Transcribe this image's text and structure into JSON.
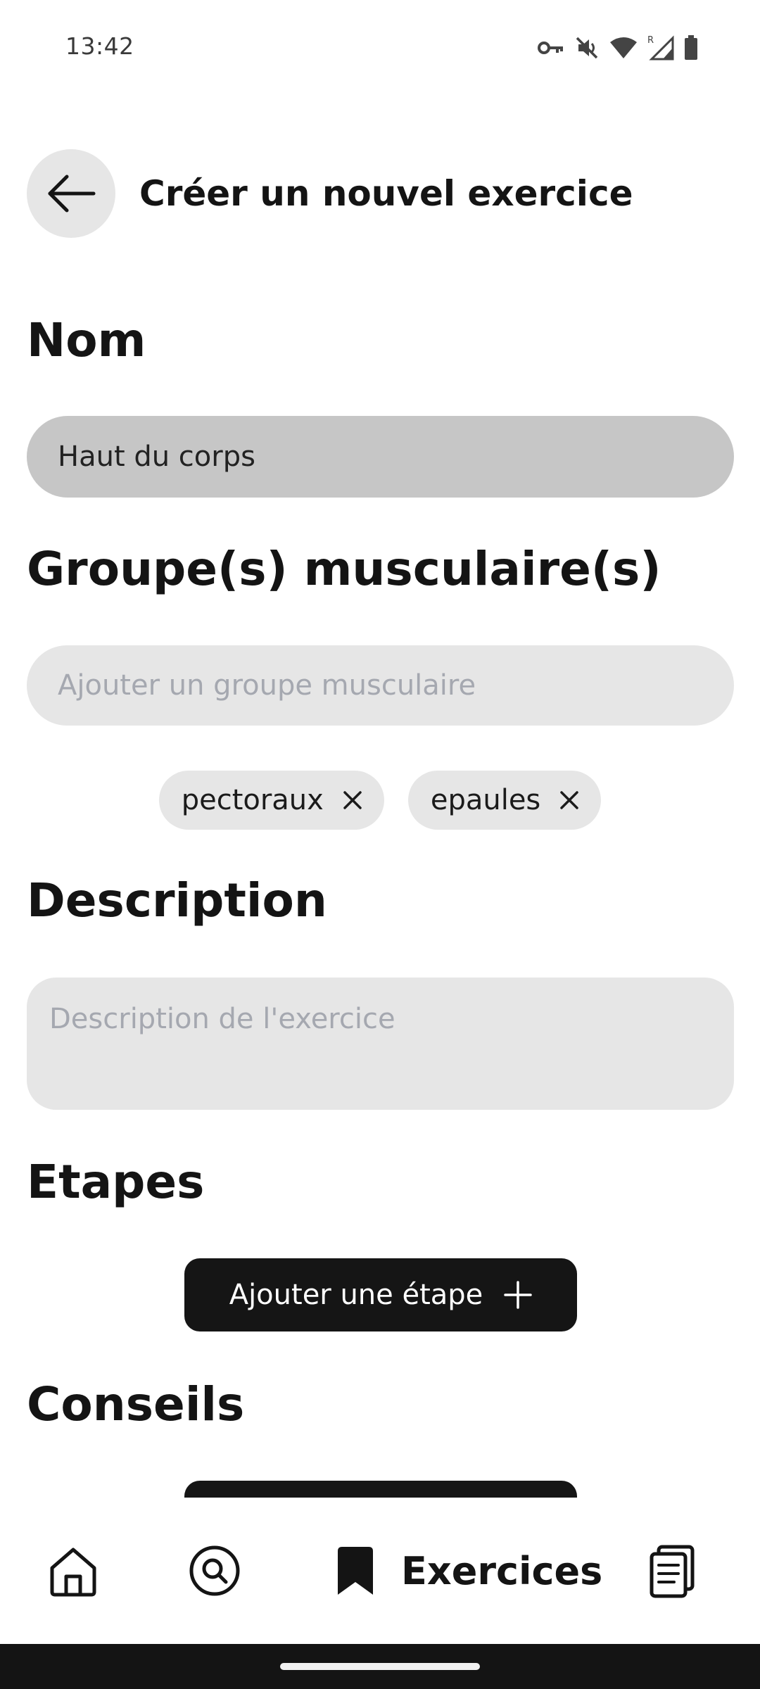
{
  "status_bar": {
    "time": "13:42",
    "icons": [
      "vpn-key-icon",
      "mute-icon",
      "wifi-icon",
      "signal-icon",
      "battery-icon"
    ]
  },
  "header": {
    "title": "Créer un nouvel exercice"
  },
  "form": {
    "name": {
      "label": "Nom",
      "value": "Haut du corps"
    },
    "muscle_groups": {
      "label": "Groupe(s) musculaire(s)",
      "placeholder": "Ajouter un groupe musculaire",
      "chips": [
        "pectoraux",
        "epaules"
      ]
    },
    "description": {
      "label": "Description",
      "placeholder": "Description de l'exercice"
    },
    "steps": {
      "label": "Etapes",
      "add_button": "Ajouter une étape"
    },
    "tips": {
      "label": "Conseils"
    }
  },
  "bottom_nav": {
    "items": [
      {
        "icon": "home-icon",
        "label": ""
      },
      {
        "icon": "search-icon",
        "label": ""
      },
      {
        "icon": "bookmark-icon",
        "label": "Exercices",
        "active": true
      },
      {
        "icon": "clipboard-icon",
        "label": ""
      }
    ]
  },
  "colors": {
    "accent": "#151515",
    "input_filled": "#c6c6c6",
    "input_bg": "#e6e6e6",
    "placeholder": "#a5a8b0"
  }
}
